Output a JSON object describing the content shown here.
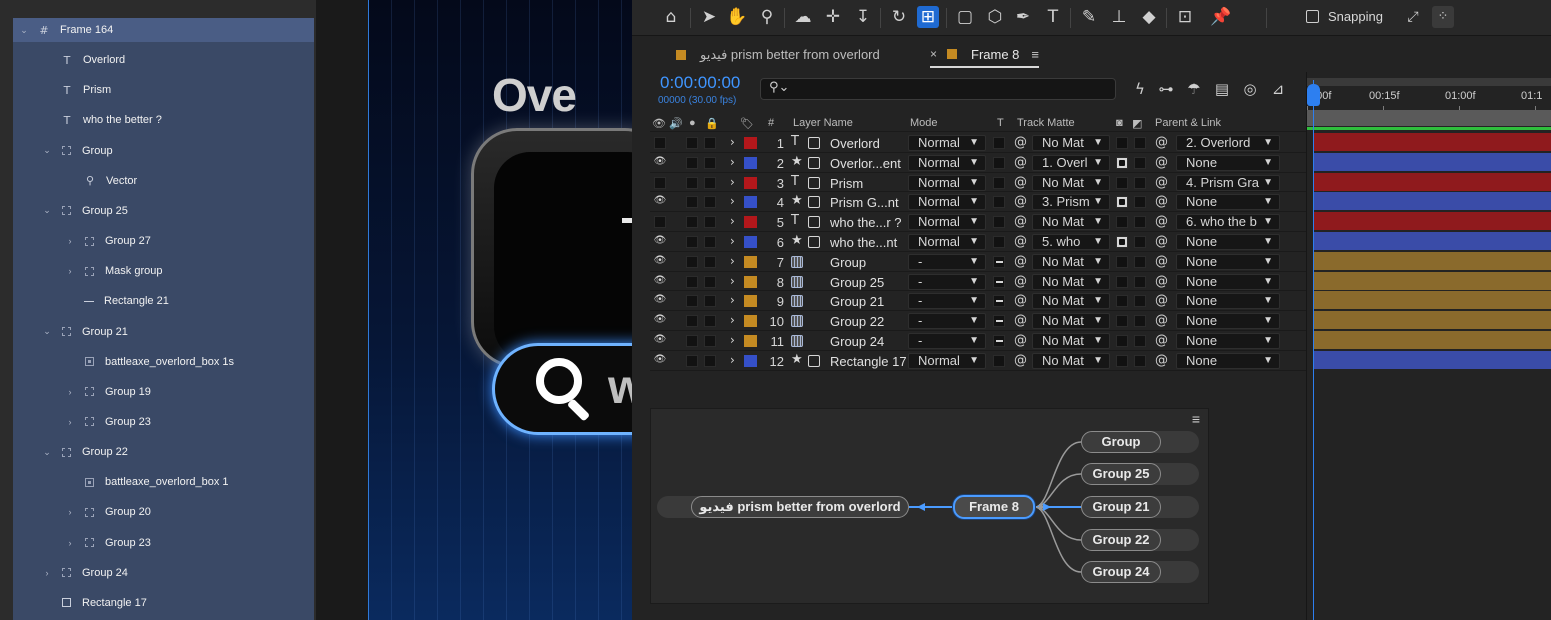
{
  "figma": {
    "layers": [
      {
        "name": "Frame 164",
        "icon": "frame-icon",
        "indent": 0,
        "expanded": true,
        "selected": true
      },
      {
        "name": "Overlord",
        "icon": "text-icon",
        "indent": 1
      },
      {
        "name": "Prism",
        "icon": "text-icon",
        "indent": 1
      },
      {
        "name": "who the better ?",
        "icon": "text-icon",
        "indent": 1
      },
      {
        "name": "Group",
        "icon": "group-icon",
        "indent": 1,
        "expanded": true
      },
      {
        "name": "Vector",
        "icon": "vector-icon",
        "indent": 2
      },
      {
        "name": "Group 25",
        "icon": "group-icon",
        "indent": 1,
        "expanded": true
      },
      {
        "name": "Group 27",
        "icon": "group-icon",
        "indent": 2,
        "collapsed": true
      },
      {
        "name": "Mask group",
        "icon": "group-icon",
        "indent": 2,
        "collapsed": true
      },
      {
        "name": "Rectangle 21",
        "icon": "line-icon",
        "indent": 2
      },
      {
        "name": "Group 21",
        "icon": "group-icon",
        "indent": 1,
        "expanded": true
      },
      {
        "name": "battleaxe_overlord_box 1s",
        "icon": "image-icon",
        "indent": 2
      },
      {
        "name": "Group 19",
        "icon": "group-icon",
        "indent": 2,
        "collapsed": true
      },
      {
        "name": "Group 23",
        "icon": "group-icon",
        "indent": 2,
        "collapsed": true
      },
      {
        "name": "Group 22",
        "icon": "group-icon",
        "indent": 1,
        "expanded": true
      },
      {
        "name": "battleaxe_overlord_box 1",
        "icon": "image-icon",
        "indent": 2
      },
      {
        "name": "Group 20",
        "icon": "group-icon",
        "indent": 2,
        "collapsed": true
      },
      {
        "name": "Group 23",
        "icon": "group-icon",
        "indent": 2,
        "collapsed": true
      },
      {
        "name": "Group 24",
        "icon": "group-icon",
        "indent": 1,
        "collapsed": true
      },
      {
        "name": "Rectangle 17",
        "icon": "rectangle-icon",
        "indent": 1
      }
    ]
  },
  "canvas": {
    "title_fragment": "Ove",
    "search_fragment": "w"
  },
  "ae": {
    "toolbar": {
      "snapping_label": "Snapping"
    },
    "tabs": [
      {
        "label": "فيديو prism better from overlord",
        "active": false
      },
      {
        "label": "Frame 8",
        "active": true
      }
    ],
    "timecode": "0:00:00:00",
    "frame_info": "00000 (30.00 fps)",
    "columns": {
      "num": "#",
      "layer_name": "Layer Name",
      "mode": "Mode",
      "t": "T",
      "track_matte": "Track Matte",
      "parent_link": "Parent & Link"
    },
    "layers": [
      {
        "num": "1",
        "type": "T",
        "name": "Overlord",
        "mode": "Normal",
        "matte": "No Mat",
        "parent": "2. Overlord",
        "label_color": "#b3171b",
        "visible": false,
        "matte_on": false,
        "mode_dash": false
      },
      {
        "num": "2",
        "type": "★",
        "name": "Overlor...ent",
        "mode": "Normal",
        "matte": "1. Overl",
        "parent": "None",
        "label_color": "#3550c8",
        "visible": true,
        "matte_on": true,
        "mode_dash": false
      },
      {
        "num": "3",
        "type": "T",
        "name": "Prism",
        "mode": "Normal",
        "matte": "No Mat",
        "parent": "4. Prism Gra",
        "label_color": "#b3171b",
        "visible": false,
        "matte_on": false,
        "mode_dash": false
      },
      {
        "num": "4",
        "type": "★",
        "name": "Prism G...nt",
        "mode": "Normal",
        "matte": "3. Prism",
        "parent": "None",
        "label_color": "#3550c8",
        "visible": true,
        "matte_on": true,
        "mode_dash": false
      },
      {
        "num": "5",
        "type": "T",
        "name": "who the...r ?",
        "mode": "Normal",
        "matte": "No Mat",
        "parent": "6. who the b",
        "label_color": "#b3171b",
        "visible": false,
        "matte_on": false,
        "mode_dash": false
      },
      {
        "num": "6",
        "type": "★",
        "name": "who the...nt",
        "mode": "Normal",
        "matte": "5. who",
        "parent": "None",
        "label_color": "#3550c8",
        "visible": true,
        "matte_on": true,
        "mode_dash": false
      },
      {
        "num": "7",
        "type": "comp",
        "name": "Group",
        "mode": "-",
        "matte": "No Mat",
        "parent": "None",
        "label_color": "#c48a22",
        "visible": true,
        "matte_on": false,
        "mode_dash": true
      },
      {
        "num": "8",
        "type": "comp",
        "name": "Group 25",
        "mode": "-",
        "matte": "No Mat",
        "parent": "None",
        "label_color": "#c48a22",
        "visible": true,
        "matte_on": false,
        "mode_dash": true
      },
      {
        "num": "9",
        "type": "comp",
        "name": "Group 21",
        "mode": "-",
        "matte": "No Mat",
        "parent": "None",
        "label_color": "#c48a22",
        "visible": true,
        "matte_on": false,
        "mode_dash": true
      },
      {
        "num": "10",
        "type": "comp",
        "name": "Group 22",
        "mode": "-",
        "matte": "No Mat",
        "parent": "None",
        "label_color": "#c48a22",
        "visible": true,
        "matte_on": false,
        "mode_dash": true
      },
      {
        "num": "11",
        "type": "comp",
        "name": "Group 24",
        "mode": "-",
        "matte": "No Mat",
        "parent": "None",
        "label_color": "#c48a22",
        "visible": true,
        "matte_on": false,
        "mode_dash": true
      },
      {
        "num": "12",
        "type": "★",
        "name": "Rectangle 17",
        "mode": "Normal",
        "matte": "No Mat",
        "parent": "None",
        "label_color": "#3550c8",
        "visible": true,
        "matte_on": false,
        "mode_dash": false
      }
    ],
    "timeline": {
      "ticks": [
        "0:00f",
        "00:15f",
        "01:00f",
        "01:1"
      ],
      "bar_colors": [
        "#8f1a1d",
        "#3a4ca8",
        "#8f1a1d",
        "#3a4ca8",
        "#8f1a1d",
        "#3a4ca8",
        "#8a6a2c",
        "#8a6a2c",
        "#8a6a2c",
        "#8a6a2c",
        "#8a6a2c",
        "#3a4ca8"
      ]
    },
    "flowchart": {
      "main_node": "Frame 8",
      "parent_node": "فيديو prism better from overlord",
      "children": [
        "Group",
        "Group 25",
        "Group 21",
        "Group 22",
        "Group 24"
      ]
    }
  }
}
